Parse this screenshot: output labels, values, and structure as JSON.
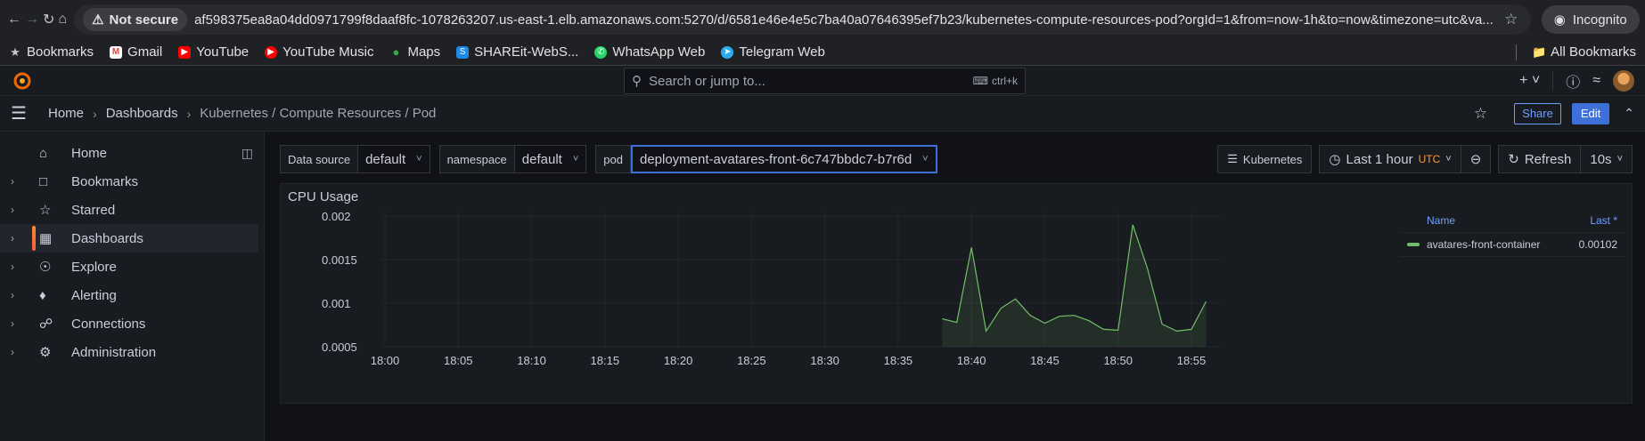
{
  "browser": {
    "not_secure": "Not secure",
    "url": "af598375ea8a04dd0971799f8daaf8fc-1078263207.us-east-1.elb.amazonaws.com:5270/d/6581e46e4e5c7ba40a07646395ef7b23/kubernetes-compute-resources-pod?orgId=1&from=now-1h&to=now&timezone=utc&va...",
    "incognito": "Incognito"
  },
  "bookmarks": {
    "items": [
      "Bookmarks",
      "Gmail",
      "YouTube",
      "YouTube Music",
      "Maps",
      "SHAREit-WebS...",
      "WhatsApp Web",
      "Telegram Web"
    ],
    "all": "All Bookmarks"
  },
  "grafana": {
    "search_placeholder": "Search or jump to...",
    "search_shortcut": "ctrl+k",
    "breadcrumb": [
      "Home",
      "Dashboards",
      "Kubernetes / Compute Resources / Pod"
    ],
    "share": "Share",
    "edit": "Edit"
  },
  "sidebar": {
    "items": [
      "Home",
      "Bookmarks",
      "Starred",
      "Dashboards",
      "Explore",
      "Alerting",
      "Connections",
      "Administration"
    ],
    "active": "Dashboards"
  },
  "variables": {
    "datasource_label": "Data source",
    "datasource_value": "default",
    "namespace_label": "namespace",
    "namespace_value": "default",
    "pod_label": "pod",
    "pod_value": "deployment-avatares-front-6c747bbdc7-b7r6d"
  },
  "toolbar": {
    "kubernetes": "Kubernetes",
    "time_range": "Last 1 hour",
    "timezone": "UTC",
    "refresh": "Refresh",
    "interval": "10s"
  },
  "panel": {
    "title": "CPU Usage",
    "legend_name_header": "Name",
    "legend_last_header": "Last *"
  },
  "chart_data": {
    "type": "area",
    "title": "CPU Usage",
    "x_ticks": [
      "18:00",
      "18:05",
      "18:10",
      "18:15",
      "18:20",
      "18:25",
      "18:30",
      "18:35",
      "18:40",
      "18:45",
      "18:50",
      "18:55"
    ],
    "y_ticks": [
      "0.002",
      "0.0015",
      "0.001",
      "0.0005"
    ],
    "ylim": [
      0.0005,
      0.002
    ],
    "grid": true,
    "legend_placement": "right",
    "series": [
      {
        "name": "avatares-front-container",
        "color": "#73bf69",
        "last": "0.00102",
        "x": [
          "18:38",
          "18:39",
          "18:40",
          "18:41",
          "18:42",
          "18:43",
          "18:44",
          "18:45",
          "18:46",
          "18:47",
          "18:48",
          "18:49",
          "18:50",
          "18:51",
          "18:52",
          "18:53",
          "18:54",
          "18:55",
          "18:56"
        ],
        "values": [
          0.00082,
          0.00078,
          0.00164,
          0.00068,
          0.00094,
          0.00105,
          0.00086,
          0.00077,
          0.00085,
          0.00086,
          0.0008,
          0.0007,
          0.00069,
          0.0019,
          0.0014,
          0.00076,
          0.00068,
          0.0007,
          0.00102
        ]
      }
    ]
  }
}
